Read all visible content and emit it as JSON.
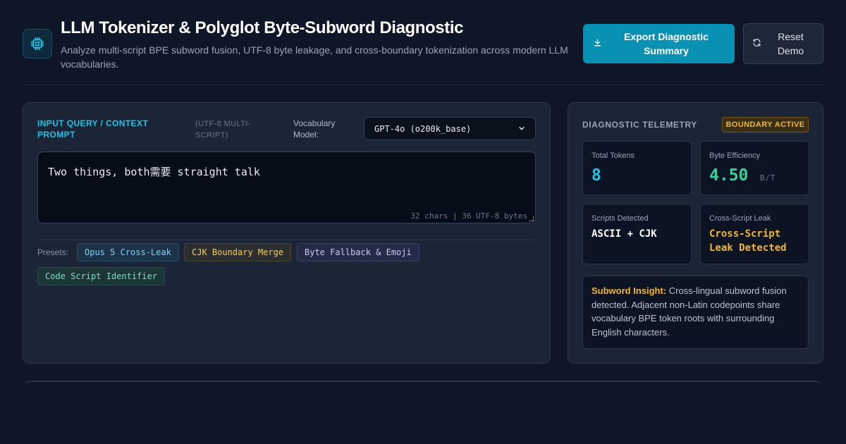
{
  "header": {
    "title": "LLM Tokenizer & Polyglot Byte-Subword Diagnostic",
    "subtitle": "Analyze multi-script BPE subword fusion, UTF-8 byte leakage, and cross-boundary tokenization across modern LLM vocabularies.",
    "export_label": "Export Diagnostic Summary",
    "reset_label": "Reset Demo"
  },
  "input": {
    "label": "INPUT QUERY / CONTEXT PROMPT",
    "sublabel": "(UTF-8 MULTI-SCRIPT)",
    "vocab_label": "Vocabulary Model:",
    "vocab_selected": "GPT-4o (o200k_base)",
    "text": "Two things, both需要 straight talk",
    "count": "32 chars | 36 UTF-8 bytes"
  },
  "presets": {
    "label": "Presets:",
    "items": [
      "Opus 5 Cross-Leak",
      "CJK Boundary Merge",
      "Byte Fallback & Emoji",
      "Code Script Identifier"
    ]
  },
  "telemetry": {
    "title": "DIAGNOSTIC TELEMETRY",
    "badge": "BOUNDARY ACTIVE",
    "total_tokens_label": "Total Tokens",
    "total_tokens": "8",
    "byte_eff_label": "Byte Efficiency",
    "byte_eff": "4.50",
    "byte_eff_unit": "B/T",
    "scripts_label": "Scripts Detected",
    "scripts": "ASCII + CJK",
    "leak_label": "Cross-Script Leak",
    "leak": "Cross-Script Leak Detected",
    "insight_title": "Subword Insight:",
    "insight_text": " Cross-lingual subword fusion detected. Adjacent non-Latin codepoints share vocabulary BPE token roots with surrounding English characters."
  },
  "colors": {
    "accent": "#22c3e6",
    "export_bg": "#0891b2",
    "warning": "#f2b733",
    "success": "#34d399"
  },
  "icons": {
    "logo": "cpu-chip-icon",
    "export": "download-icon",
    "reset": "refresh-icon",
    "select": "chevron-down-icon"
  }
}
